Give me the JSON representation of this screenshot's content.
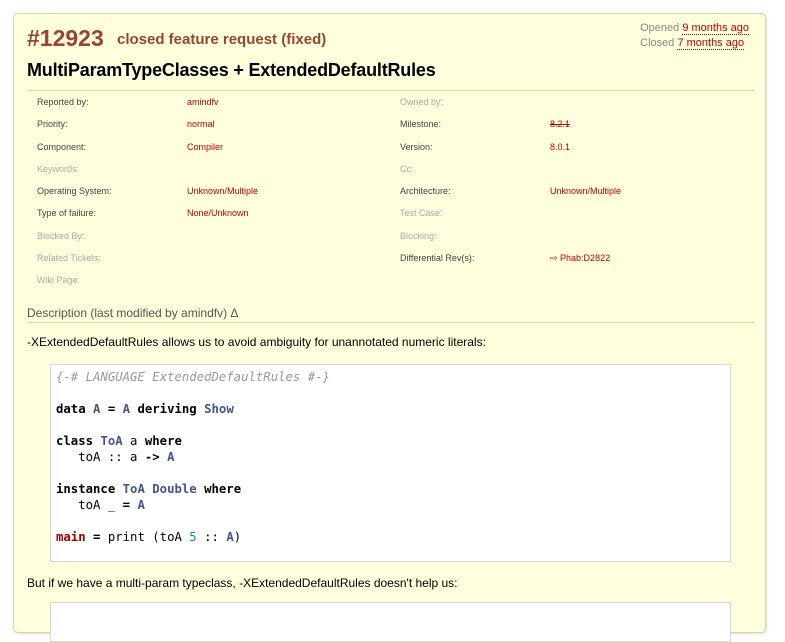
{
  "ticket": {
    "id": "#12923",
    "type": "closed feature request (fixed)",
    "summary": "MultiParamTypeClasses + ExtendedDefaultRules",
    "opened_label": "Opened",
    "opened_time": "9 months ago",
    "closed_label": "Closed",
    "closed_time": "7 months ago"
  },
  "properties": [
    {
      "l1": "Reported by:",
      "v1": "amindfv",
      "l2": "Owned by:",
      "v2": ""
    },
    {
      "l1": "Priority:",
      "v1": "normal",
      "l2": "Milestone:",
      "v2": "8.2.1"
    },
    {
      "l1": "Component:",
      "v1": "Compiler",
      "l2": "Version:",
      "v2": "8.0.1"
    },
    {
      "l1": "Keywords:",
      "v1": "",
      "l2": "Cc:",
      "v2": ""
    },
    {
      "l1": "Operating System:",
      "v1": "Unknown/Multiple",
      "l2": "Architecture:",
      "v2": "Unknown/Multiple"
    },
    {
      "l1": "Type of failure:",
      "v1": "None/Unknown",
      "l2": "Test Case:",
      "v2": ""
    },
    {
      "l1": "Blocked By:",
      "v1": "",
      "l2": "Blocking:",
      "v2": ""
    },
    {
      "l1": "Related Tickets:",
      "v1": "",
      "l2": "Differential Rev(s):",
      "v2": "⇨ Phab:D2822"
    },
    {
      "l1": "Wiki Page:",
      "v1": "",
      "l2": "",
      "v2": ""
    }
  ],
  "description": {
    "heading": "Description (last modified by amindfv)",
    "delta": "Δ",
    "paragraph1": "-XExtendedDefaultRules allows us to avoid ambiguity for unannotated numeric literals:",
    "paragraph2": "But if we have a multi-param typeclass, -XExtendedDefaultRules doesn't help us:",
    "code": {
      "pragma": "{-# LANGUAGE ExtendedDefaultRules #-}",
      "kw_data": "data",
      "kw_deriving": "deriving",
      "kw_class": "class",
      "kw_where": "where",
      "kw_instance": "instance",
      "ty_A": "A",
      "ty_Show": "Show",
      "ty_ToA": "ToA",
      "ty_Double": "Double",
      "main": "main",
      "num_5": "5"
    }
  }
}
